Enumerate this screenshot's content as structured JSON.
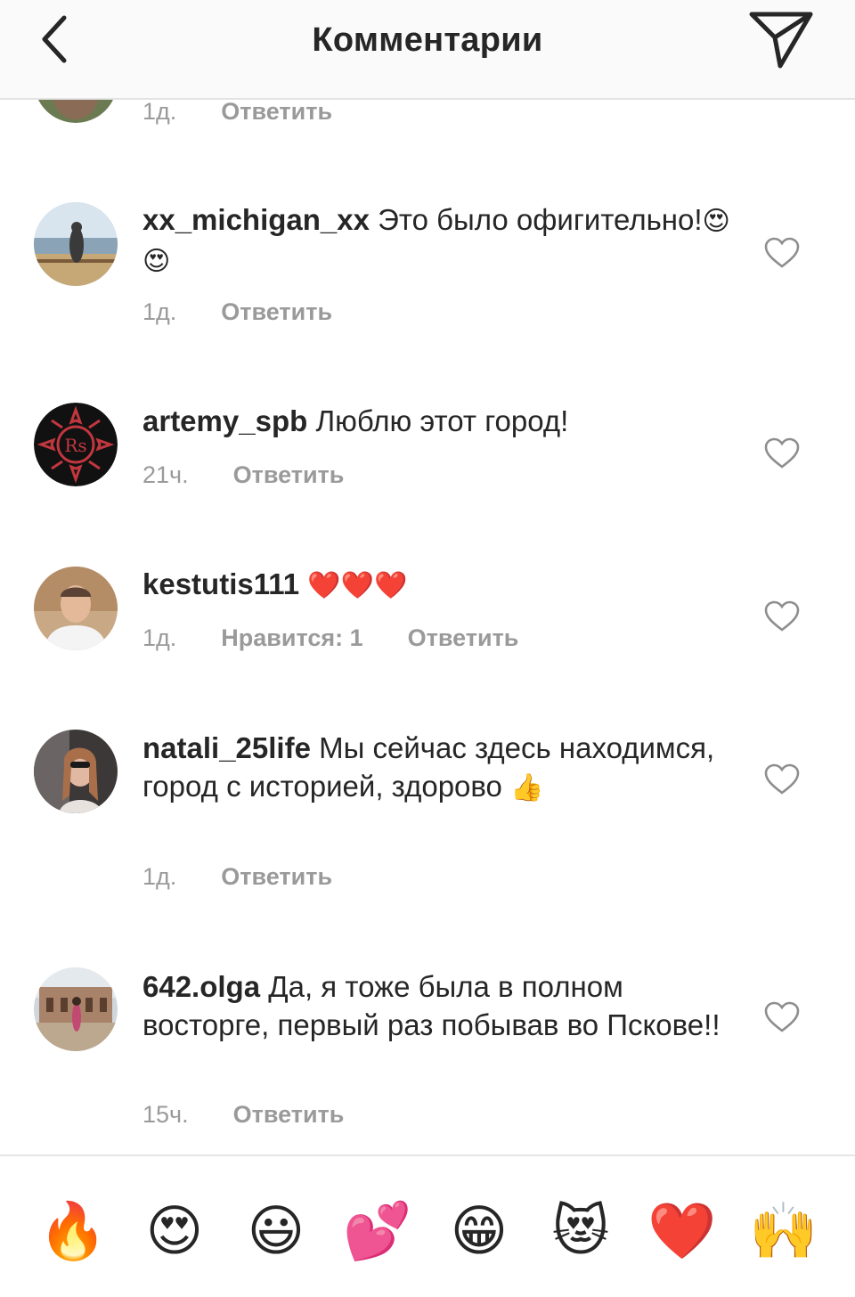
{
  "header": {
    "title": "Комментарии",
    "back_icon": "chevron-left-icon",
    "direct_icon": "paper-plane-icon"
  },
  "top_partial": {
    "time": "1д.",
    "reply": "Ответить"
  },
  "comments": [
    {
      "username": "xx_michigan_xx",
      "text": "Это было офигительно!",
      "emoji": "😍 😍",
      "time": "1д.",
      "reply": "Ответить"
    },
    {
      "username": "artemy_spb",
      "text": "Люблю этот город!",
      "emoji": "",
      "time": "21ч.",
      "reply": "Ответить"
    },
    {
      "username": "kestutis111",
      "text": "",
      "emoji": "❤️❤️❤️",
      "time": "1д.",
      "likes": "Нравится: 1",
      "reply": "Ответить"
    },
    {
      "username": "natali_25life",
      "text": "Мы сейчас здесь находимся, город с историей, здорово",
      "emoji": "👍",
      "time": "1д.",
      "reply": "Ответить"
    },
    {
      "username": "642.olga",
      "text": "Да, я тоже была в полном восторге, первый раз побывав во Пскове!!",
      "emoji": "",
      "time": "15ч.",
      "reply": "Ответить"
    }
  ],
  "emoji_bar": [
    "🔥",
    "😍",
    "😃",
    "💕",
    "😁",
    "😻",
    "❤️",
    "🙌"
  ],
  "colors": {
    "text": "#262626",
    "meta": "#9a9a9a",
    "header_bg": "#fafafa",
    "divider": "#e6e6e6"
  }
}
